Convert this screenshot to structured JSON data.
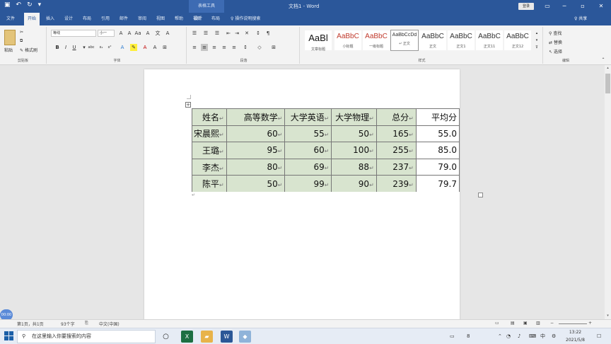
{
  "window": {
    "title": "文档1 - Word",
    "context_tab": "表格工具",
    "login_label": "登录",
    "share_label": "♀ 共享",
    "tell_me": "操作说明搜索"
  },
  "tabs": [
    "文件",
    "开始",
    "插入",
    "设计",
    "布局",
    "引用",
    "邮件",
    "审阅",
    "视图",
    "帮助",
    "福昕",
    "设计",
    "布局"
  ],
  "ribbon": {
    "groups": {
      "clipboard": "剪贴板",
      "font": "字体",
      "paragraph": "段落",
      "styles": "样式",
      "editing": "编辑"
    },
    "paste_label": "粘贴",
    "format_painter": "格式刷",
    "font_name": "等线",
    "font_size": "小一",
    "styles": [
      {
        "sample": "AaBl",
        "name": "文章标题"
      },
      {
        "sample": "AaBbC",
        "name": "小标题"
      },
      {
        "sample": "AaBbC",
        "name": "一级标题"
      },
      {
        "sample": "AaBbCcDd",
        "name": "↵ 正文"
      },
      {
        "sample": "AaBbC",
        "name": "正文"
      },
      {
        "sample": "AaBbC",
        "name": "正文1"
      },
      {
        "sample": "AaBbC",
        "name": "正文11"
      },
      {
        "sample": "AaBbC",
        "name": "正文12"
      }
    ],
    "editing": {
      "find": "查找",
      "replace": "替换",
      "select": "选择"
    }
  },
  "table": {
    "headers": [
      "姓名",
      "高等数学",
      "大学英语",
      "大学物理",
      "总分",
      "平均分"
    ],
    "rows": [
      [
        "宋晨熙",
        "60",
        "55",
        "50",
        "165",
        "55.0"
      ],
      [
        "王璐",
        "95",
        "60",
        "100",
        "255",
        "85.0"
      ],
      [
        "李杰",
        "80",
        "69",
        "88",
        "237",
        "79.0"
      ],
      [
        "陈平",
        "50",
        "99",
        "90",
        "239",
        "79.7"
      ]
    ]
  },
  "status_bar": {
    "page": "第1页，共1页",
    "words": "93个字",
    "language": "中文(中国)",
    "record_badge": "00:00"
  },
  "taskbar": {
    "search_placeholder": "在这里输入你要搜索的内容",
    "time": "13:22",
    "date": "2021/5/8",
    "ime": "中",
    "notification_count": "8"
  },
  "colors": {
    "word_blue": "#2b579a",
    "table_fill": "#d8e4cf",
    "excel_green": "#1d6f42",
    "word_icon_blue": "#2b5797"
  }
}
